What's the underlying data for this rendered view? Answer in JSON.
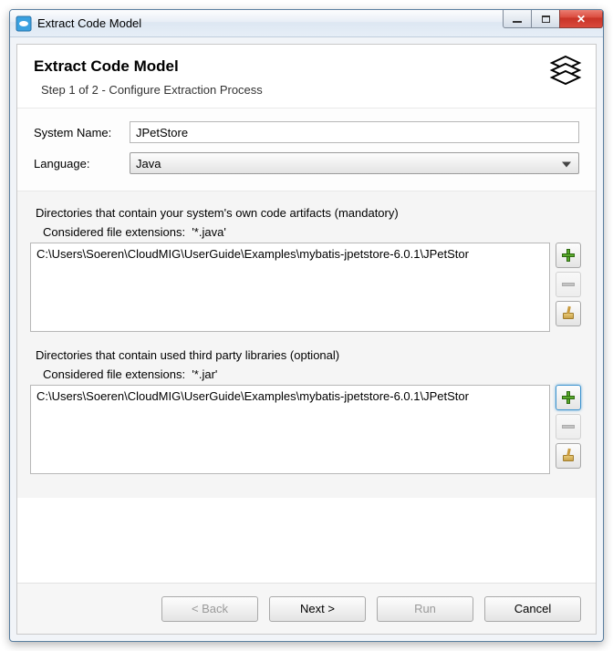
{
  "window": {
    "title": "Extract Code Model"
  },
  "header": {
    "title": "Extract Code Model",
    "subtitle": "Step 1 of 2 - Configure Extraction Process"
  },
  "form": {
    "system_name_label": "System Name:",
    "system_name_value": "JPetStore",
    "language_label": "Language:",
    "language_value": "Java"
  },
  "groups": {
    "own": {
      "title": "Directories that contain your system's own code artifacts (mandatory)",
      "ext_label": "Considered file extensions:",
      "ext_value": "'*.java'",
      "items": [
        "C:\\Users\\Soeren\\CloudMIG\\UserGuide\\Examples\\mybatis-jpetstore-6.0.1\\JPetStor"
      ]
    },
    "libs": {
      "title": "Directories that contain used third party libraries (optional)",
      "ext_label": "Considered file extensions:",
      "ext_value": "'*.jar'",
      "items": [
        "C:\\Users\\Soeren\\CloudMIG\\UserGuide\\Examples\\mybatis-jpetstore-6.0.1\\JPetStor"
      ]
    }
  },
  "footer": {
    "back": "< Back",
    "next": "Next >",
    "run": "Run",
    "cancel": "Cancel"
  }
}
